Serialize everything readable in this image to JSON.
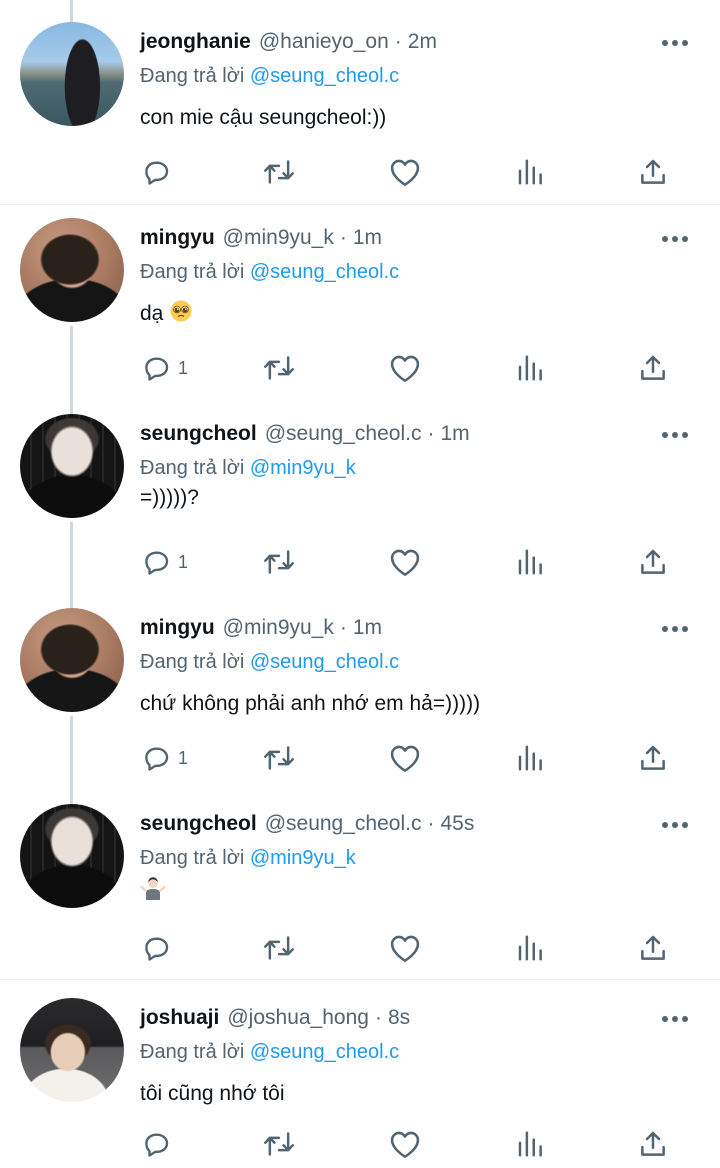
{
  "reply_prefix": "Đang trả lời",
  "colors": {
    "accent": "#1d9bf0",
    "secondary_text": "#536471",
    "thread_line": "#cfd9de"
  },
  "tweets": [
    {
      "name": "jeonghanie",
      "handle": "@hanieyo_on",
      "separator": "·",
      "time": "2m",
      "reply_to": "@seung_cheol.c",
      "text": "con mie cậu seungcheol:))",
      "reply_count": "",
      "avatar_icon": "avatar-photo"
    },
    {
      "name": "mingyu",
      "handle": "@min9yu_k",
      "separator": "·",
      "time": "1m",
      "reply_to": "@seung_cheol.c",
      "text": "dạ",
      "text_emoji": "pleading-face-emoji",
      "reply_count": "1",
      "avatar_icon": "avatar-photo"
    },
    {
      "name": "seungcheol",
      "handle": "@seung_cheol.c",
      "separator": "·",
      "time": "1m",
      "reply_to": "@min9yu_k",
      "text": "=)))))?",
      "reply_count": "1",
      "avatar_icon": "avatar-photo"
    },
    {
      "name": "mingyu",
      "handle": "@min9yu_k",
      "separator": "·",
      "time": "1m",
      "reply_to": "@seung_cheol.c",
      "text": "chứ không phải anh nhớ em hả=)))))",
      "reply_count": "1",
      "avatar_icon": "avatar-photo"
    },
    {
      "name": "seungcheol",
      "handle": "@seung_cheol.c",
      "separator": "·",
      "time": "45s",
      "reply_to": "@min9yu_k",
      "text": "",
      "text_emoji": "person-shrugging-emoji",
      "reply_count": "",
      "avatar_icon": "avatar-photo"
    },
    {
      "name": "joshuaji",
      "handle": "@joshua_hong",
      "separator": "·",
      "time": "8s",
      "reply_to": "@seung_cheol.c",
      "text": "tôi cũng nhớ tôi",
      "reply_count": "",
      "avatar_icon": "avatar-photo"
    }
  ],
  "action_icons": [
    "reply-icon",
    "retweet-icon",
    "like-icon",
    "views-icon",
    "share-icon"
  ]
}
